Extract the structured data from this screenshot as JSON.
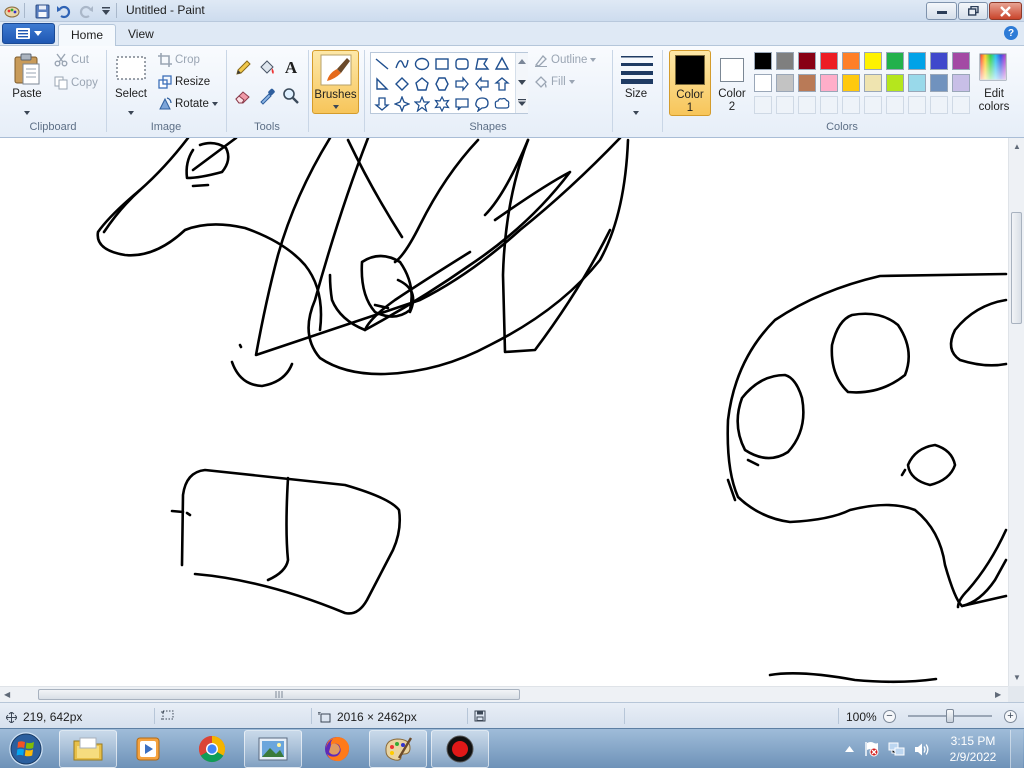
{
  "window": {
    "title": "Untitled - Paint",
    "tabs": [
      {
        "label": "Home",
        "active": true
      },
      {
        "label": "View",
        "active": false
      }
    ],
    "help": "?"
  },
  "ribbon": {
    "clipboard": {
      "label": "Clipboard",
      "paste": "Paste",
      "cut": "Cut",
      "copy": "Copy"
    },
    "image": {
      "label": "Image",
      "select": "Select",
      "crop": "Crop",
      "resize": "Resize",
      "rotate": "Rotate"
    },
    "tools": {
      "label": "Tools",
      "text_glyph": "A"
    },
    "brushes": {
      "label": "Brushes"
    },
    "shapes": {
      "label": "Shapes",
      "outline": "Outline",
      "fill": "Fill"
    },
    "size": {
      "label": "Size"
    },
    "color1": {
      "label_line1": "Color",
      "label_line2": "1",
      "color": "#000000"
    },
    "color2": {
      "label_line1": "Color",
      "label_line2": "2",
      "color": "#ffffff"
    },
    "colors": {
      "label": "Colors",
      "edit_line1": "Edit",
      "edit_line2": "colors",
      "row1": [
        "#000000",
        "#7f7f7f",
        "#880015",
        "#ed1c24",
        "#ff7f27",
        "#fff200",
        "#22b14c",
        "#00a2e8",
        "#3f48cc",
        "#a349a4"
      ],
      "row2": [
        "#ffffff",
        "#c3c3c3",
        "#b97a57",
        "#ffaec9",
        "#ffc90e",
        "#efe4b0",
        "#b5e61d",
        "#99d9ea",
        "#7092be",
        "#c8bfe7"
      ]
    }
  },
  "status": {
    "cursor_pos": "219, 642px",
    "image_size": "2016 × 2462px",
    "zoom": "100%",
    "zoom_level": 0.5
  },
  "taskbar": {
    "time": "3:15 PM",
    "date": "2/9/2022"
  }
}
